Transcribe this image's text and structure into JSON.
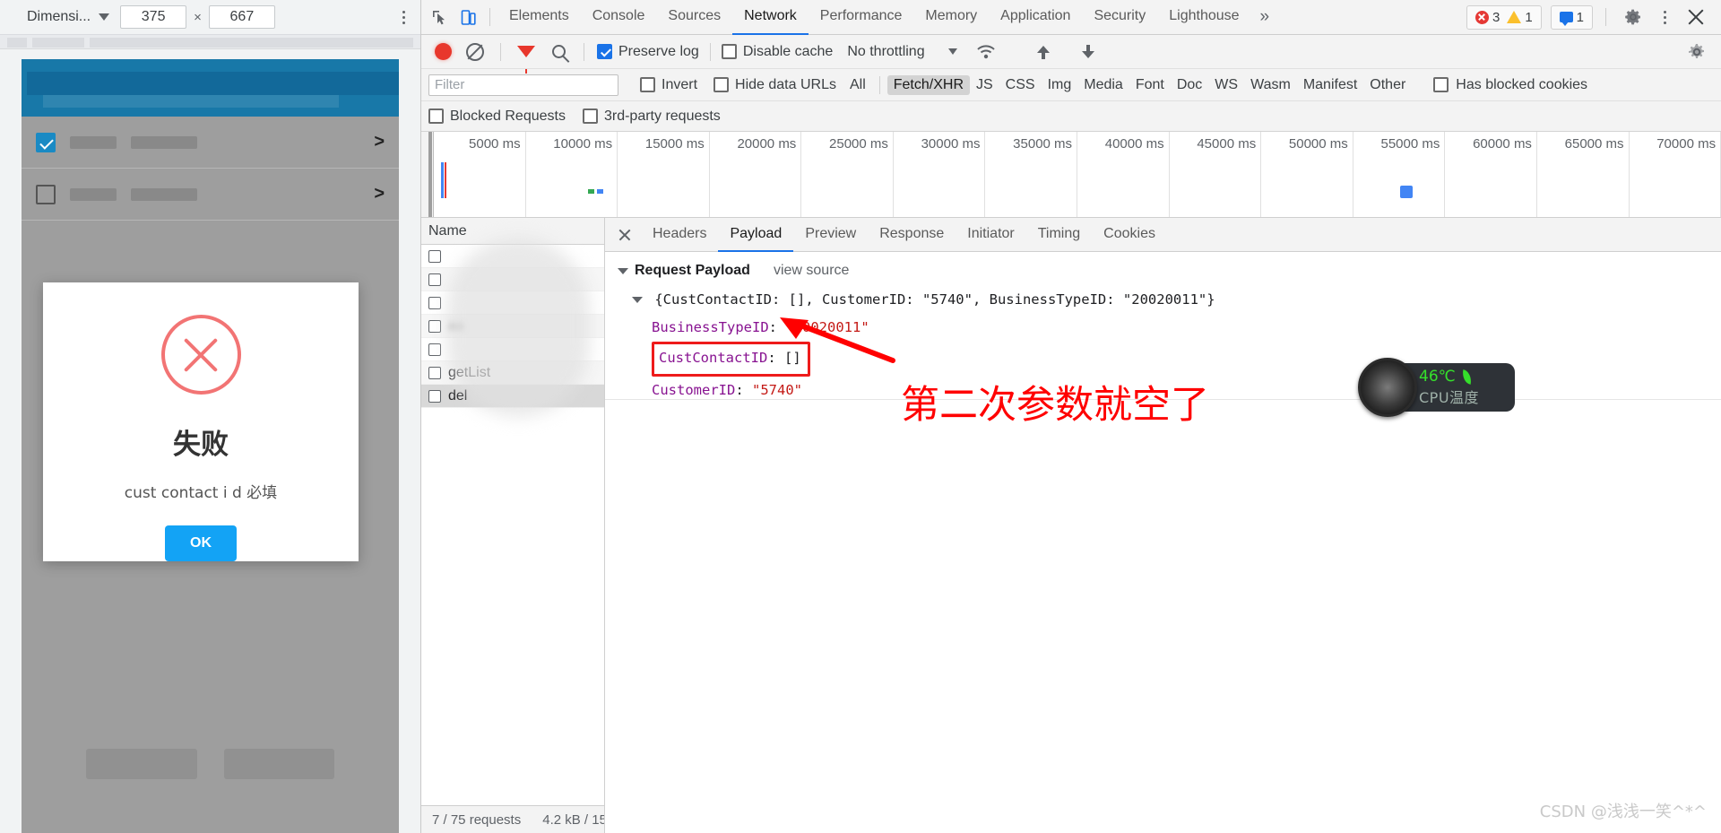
{
  "device_toolbar": {
    "device_select_label": "Dimensi...",
    "width_value": "375",
    "height_value": "667",
    "times_symbol": "×",
    "more_options_icon": "kebab-menu-icon"
  },
  "device_modal": {
    "icon": "error-x-circle-icon",
    "title": "失败",
    "message": "cust contact i d 必填",
    "ok_label": "OK"
  },
  "devtools_tabs": {
    "inspect_icon": "inspect-element-icon",
    "device_toggle_icon": "device-toolbar-icon",
    "items": [
      {
        "label": "Elements",
        "active": false
      },
      {
        "label": "Console",
        "active": false
      },
      {
        "label": "Sources",
        "active": false
      },
      {
        "label": "Network",
        "active": true
      },
      {
        "label": "Performance",
        "active": false
      },
      {
        "label": "Memory",
        "active": false
      },
      {
        "label": "Application",
        "active": false
      },
      {
        "label": "Security",
        "active": false
      },
      {
        "label": "Lighthouse",
        "active": false
      }
    ],
    "overflow_label": "»",
    "errors_count": "3",
    "warnings_count": "1",
    "messages_count": "1",
    "settings_icon": "gear-icon",
    "more_icon": "kebab-menu-icon",
    "close_icon": "close-icon"
  },
  "network_toolbar": {
    "record_icon": "record-stop-icon",
    "clear_icon": "clear-icon",
    "filter_icon": "filter-funnel-icon",
    "search_icon": "search-icon",
    "preserve_log_label": "Preserve log",
    "preserve_log_checked": true,
    "disable_cache_label": "Disable cache",
    "disable_cache_checked": false,
    "throttling_value": "No throttling",
    "wifi_icon": "network-conditions-icon",
    "import_icon": "import-har-icon",
    "export_icon": "export-har-icon",
    "settings_icon": "gear-icon"
  },
  "filter_bar": {
    "filter_placeholder": "Filter",
    "filter_value": "",
    "invert_label": "Invert",
    "invert_checked": false,
    "hide_data_urls_label": "Hide data URLs",
    "hide_data_urls_checked": false,
    "types": [
      {
        "label": "All",
        "active": false
      },
      {
        "label": "Fetch/XHR",
        "active": true
      },
      {
        "label": "JS",
        "active": false
      },
      {
        "label": "CSS",
        "active": false
      },
      {
        "label": "Img",
        "active": false
      },
      {
        "label": "Media",
        "active": false
      },
      {
        "label": "Font",
        "active": false
      },
      {
        "label": "Doc",
        "active": false
      },
      {
        "label": "WS",
        "active": false
      },
      {
        "label": "Wasm",
        "active": false
      },
      {
        "label": "Manifest",
        "active": false
      },
      {
        "label": "Other",
        "active": false
      }
    ],
    "has_blocked_cookies_label": "Has blocked cookies",
    "has_blocked_cookies_checked": false,
    "blocked_requests_label": "Blocked Requests",
    "blocked_requests_checked": false,
    "third_party_label": "3rd-party requests",
    "third_party_checked": false
  },
  "overview_timeline": {
    "ticks": [
      "5000 ms",
      "10000 ms",
      "15000 ms",
      "20000 ms",
      "25000 ms",
      "30000 ms",
      "35000 ms",
      "40000 ms",
      "45000 ms",
      "50000 ms",
      "55000 ms",
      "60000 ms",
      "65000 ms",
      "70000 ms"
    ]
  },
  "request_list": {
    "column_header": "Name",
    "rows": [
      {
        "name": "",
        "redacted": true,
        "selected": false
      },
      {
        "name": "",
        "redacted": true,
        "selected": false
      },
      {
        "name": "",
        "redacted": true,
        "selected": false
      },
      {
        "name": "aa",
        "redacted": true,
        "selected": false
      },
      {
        "name": "",
        "redacted": true,
        "selected": false
      },
      {
        "name": "getList",
        "redacted": false,
        "selected": false
      },
      {
        "name": "del",
        "redacted": false,
        "selected": true
      }
    ],
    "status": {
      "requests": "7 / 75 requests",
      "transferred": "4.2 kB / 15"
    }
  },
  "detail_panel": {
    "close_icon": "close-icon",
    "tabs": [
      {
        "label": "Headers",
        "active": false
      },
      {
        "label": "Payload",
        "active": true
      },
      {
        "label": "Preview",
        "active": false
      },
      {
        "label": "Response",
        "active": false
      },
      {
        "label": "Initiator",
        "active": false
      },
      {
        "label": "Timing",
        "active": false
      },
      {
        "label": "Cookies",
        "active": false
      }
    ],
    "payload": {
      "section_title": "Request Payload",
      "view_source_label": "view source",
      "summary": "{CustContactID: [], CustomerID: \"5740\", BusinessTypeID: \"20020011\"}",
      "entries": [
        {
          "key": "BusinessTypeID",
          "value": "\"20020011\"",
          "value_type": "string",
          "highlighted": false
        },
        {
          "key": "CustContactID",
          "value": "[]",
          "value_type": "plain",
          "highlighted": true
        },
        {
          "key": "CustomerID",
          "value": "\"5740\"",
          "value_type": "string",
          "highlighted": false
        }
      ]
    }
  },
  "annotation": {
    "text": "第二次参数就空了",
    "color": "#ff0000",
    "arrow_icon": "red-arrow-icon"
  },
  "cpu_widget": {
    "temperature": "46℃",
    "label": "CPU温度",
    "leaf_icon": "leaf-icon",
    "accent_color": "#35e02b"
  },
  "watermark": {
    "text": "CSDN @浅浅一笑^*^"
  }
}
